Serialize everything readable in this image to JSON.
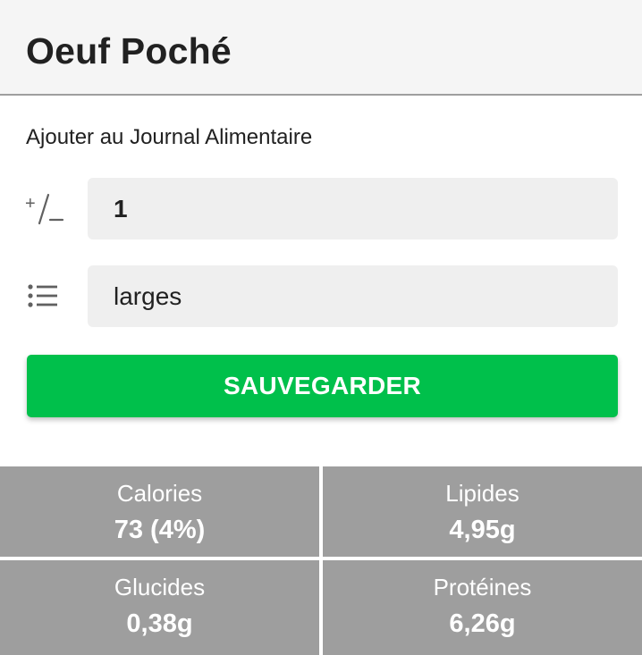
{
  "header": {
    "title": "Oeuf Poché"
  },
  "form": {
    "section_label": "Ajouter au Journal Alimentaire",
    "quantity_value": "1",
    "quantity_icon": "plus-minus-icon",
    "unit_value": "larges",
    "unit_icon": "list-icon",
    "save_label": "SAUVEGARDER"
  },
  "nutrition": {
    "calories": {
      "label": "Calories",
      "value": "73 (4%)"
    },
    "fat": {
      "label": "Lipides",
      "value": "4,95g"
    },
    "carbs": {
      "label": "Glucides",
      "value": "0,38g"
    },
    "protein": {
      "label": "Protéines",
      "value": "6,26g"
    }
  },
  "colors": {
    "accent": "#00c04b",
    "header_bg": "#f5f5f5",
    "field_bg": "#efefef",
    "tile_bg": "#9e9e9e"
  }
}
